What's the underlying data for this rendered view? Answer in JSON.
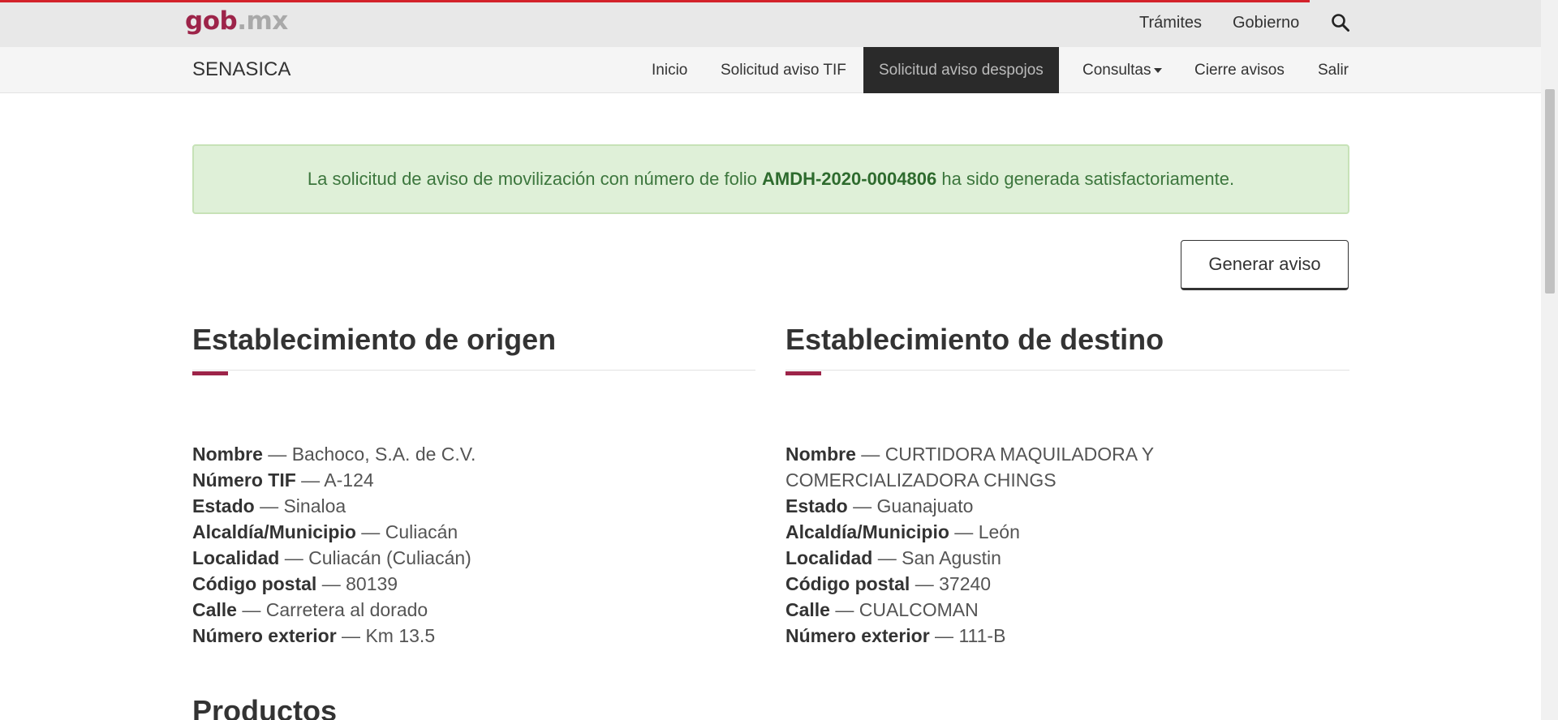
{
  "header": {
    "logo_part1": "gob",
    "logo_part2": ".mx",
    "links": [
      "Trámites",
      "Gobierno"
    ],
    "search_icon": "search-icon"
  },
  "nav": {
    "brand": "SENASICA",
    "items": [
      {
        "label": "Inicio"
      },
      {
        "label": "Solicitud aviso TIF"
      },
      {
        "label": "Solicitud aviso despojos",
        "active": true
      },
      {
        "label": "Consultas"
      },
      {
        "label": "Cierre avisos"
      },
      {
        "label": "Salir"
      }
    ]
  },
  "alert": {
    "text_before": "La solicitud de aviso de movilización con número de folio ",
    "folio": "AMDH-2020-0004806",
    "text_after": " ha sido generada satisfactoriamente."
  },
  "generate_button": "Generar aviso",
  "origin": {
    "title": "Establecimiento de origen",
    "fields": [
      {
        "label": "Nombre",
        "value": "Bachoco, S.A. de C.V."
      },
      {
        "label": "Número TIF",
        "value": "A-124"
      },
      {
        "label": "Estado",
        "value": "Sinaloa"
      },
      {
        "label": "Alcaldía/Municipio",
        "value": "Culiacán"
      },
      {
        "label": "Localidad",
        "value": "Culiacán (Culiacán)"
      },
      {
        "label": "Código postal",
        "value": "80139"
      },
      {
        "label": "Calle",
        "value": "Carretera al dorado"
      },
      {
        "label": "Número exterior",
        "value": "Km 13.5"
      }
    ]
  },
  "destination": {
    "title": "Establecimiento de destino",
    "fields": [
      {
        "label": "Nombre",
        "value": "CURTIDORA MAQUILADORA Y COMERCIALIZADORA CHINGS"
      },
      {
        "label": "Estado",
        "value": "Guanajuato"
      },
      {
        "label": "Alcaldía/Municipio",
        "value": "León"
      },
      {
        "label": "Localidad",
        "value": "San Agustin"
      },
      {
        "label": "Código postal",
        "value": "37240"
      },
      {
        "label": "Calle",
        "value": "CUALCOMAN"
      },
      {
        "label": "Número exterior",
        "value": "111-B"
      }
    ]
  },
  "products_title": "Productos",
  "separator": " — ",
  "colors": {
    "accent": "#9d2449",
    "alert_bg": "#dff0d8",
    "alert_text": "#3c763d",
    "active_nav": "#2a2a2a"
  }
}
